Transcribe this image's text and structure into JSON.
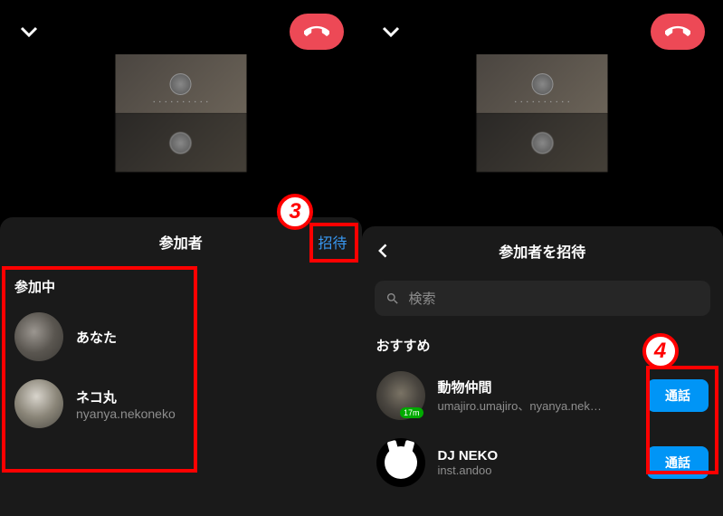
{
  "left": {
    "sheet_title": "参加者",
    "invite_link": "招待",
    "section_joining": "参加中",
    "participants": [
      {
        "name": "あなた",
        "username": ""
      },
      {
        "name": "ネコ丸",
        "username": "nyanya.nekoneko"
      }
    ]
  },
  "right": {
    "sheet_title": "参加者を招待",
    "search_placeholder": "検索",
    "section_suggested": "おすすめ",
    "call_label": "通話",
    "suggestions": [
      {
        "name": "動物仲間",
        "subtitle": "umajiro.umajiro、nyanya.nek…",
        "badge": "17m"
      },
      {
        "name": "DJ NEKO",
        "subtitle": "inst.andoo",
        "badge": ""
      }
    ]
  },
  "annotations": {
    "step3": "3",
    "step4": "4"
  }
}
